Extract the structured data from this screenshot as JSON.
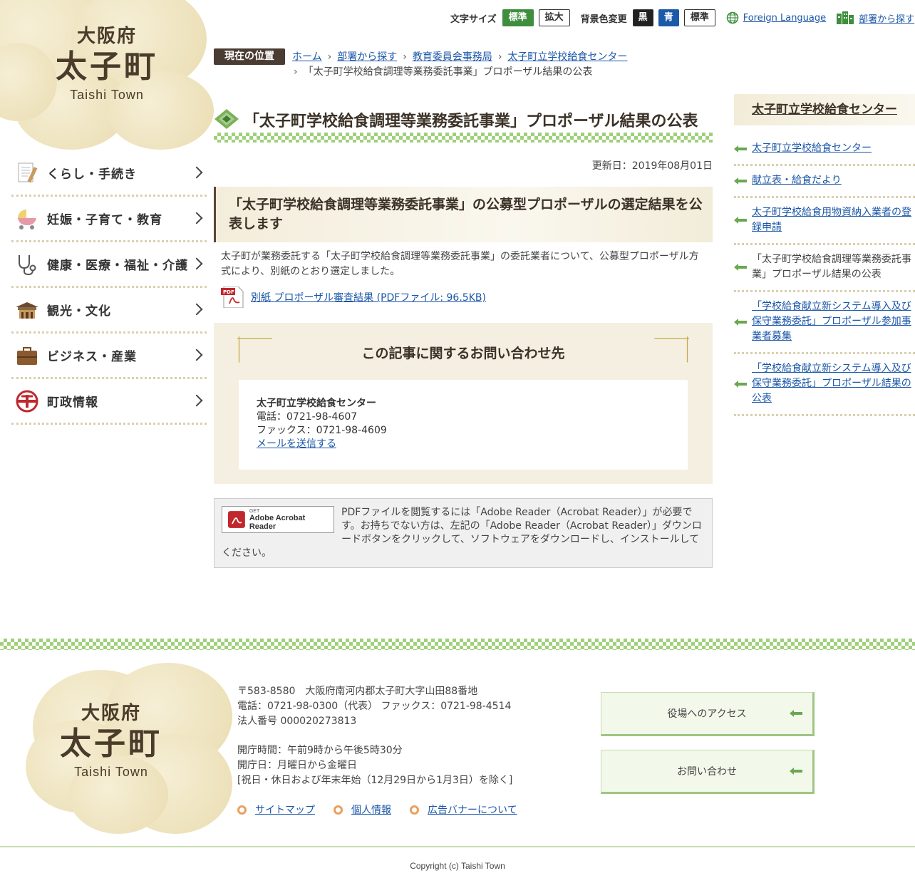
{
  "logo": {
    "pref": "大阪府",
    "town": "太子町",
    "en": "Taishi Town"
  },
  "topbar": {
    "font_size_label": "文字サイズ",
    "font_standard": "標準",
    "font_large": "拡大",
    "bg_label": "背景色変更",
    "bg_black": "黒",
    "bg_blue": "青",
    "bg_standard": "標準",
    "foreign": "Foreign Language",
    "dept": "部署から探す"
  },
  "breadcrumb": {
    "label": "現在の位置",
    "items": [
      "ホーム",
      "部署から探す",
      "教育委員会事務局",
      "太子町立学校給食センター"
    ],
    "current": "「太子町学校給食調理等業務委託事業」プロポーザル結果の公表"
  },
  "nav": {
    "items": [
      {
        "label": "くらし・手続き",
        "icon": "document-pen-icon"
      },
      {
        "label": "妊娠・子育て・教育",
        "icon": "baby-stroller-icon"
      },
      {
        "label": "健康・医療・福祉・介護",
        "icon": "stethoscope-icon"
      },
      {
        "label": "観光・文化",
        "icon": "temple-icon"
      },
      {
        "label": "ビジネス・産業",
        "icon": "briefcase-icon"
      },
      {
        "label": "町政情報",
        "icon": "town-emblem-icon"
      }
    ]
  },
  "main": {
    "title": "「太子町学校給食調理等業務委託事業」プロポーザル結果の公表",
    "updated": "更新日：2019年08月01日",
    "heading": "「太子町学校給食調理等業務委託事業」の公募型プロポーザルの選定結果を公表します",
    "body": "太子町が業務委託する「太子町学校給食調理等業務委託事業」の委託業者について、公募型プロポーザル方式により、別紙のとおり選定しました。",
    "pdf_link": "別紙 プロポーザル審査結果 (PDFファイル: 96.5KB)"
  },
  "contact": {
    "title": "この記事に関するお問い合わせ先",
    "name": "太子町立学校給食センター",
    "tel": "電話：0721-98-4607",
    "fax": "ファックス：0721-98-4609",
    "mail": "メールを送信する"
  },
  "acrobat": {
    "get": "GET",
    "product": "Adobe Acrobat Reader",
    "text": "PDFファイルを閲覧するには「Adobe Reader（Acrobat Reader）」が必要です。お持ちでない方は、左記の「Adobe Reader（Acrobat Reader）」ダウンロードボタンをクリックして、ソフトウェアをダウンロードし、インストールしてください。"
  },
  "sidebar": {
    "head": "太子町立学校給食センター",
    "items": [
      {
        "label": "太子町立学校給食センター",
        "link": true
      },
      {
        "label": "献立表・給食だより",
        "link": true
      },
      {
        "label": "太子町学校給食用物資納入業者の登録申請",
        "link": true
      },
      {
        "label": "「太子町学校給食調理等業務委託事業」プロポーザル結果の公表",
        "link": false
      },
      {
        "label": "「学校給食献立新システム導入及び保守業務委託」プロポーザル参加事業者募集",
        "link": true
      },
      {
        "label": "「学校給食献立新システム導入及び保守業務委託」プロポーザル結果の公表",
        "link": true
      }
    ]
  },
  "footer": {
    "address": "〒583-8580　大阪府南河内郡太子町大字山田88番地",
    "tel": "電話：0721-98-0300（代表） ファックス：0721-98-4514",
    "corp": "法人番号 000020273813",
    "hours": "開庁時間：午前9時から午後5時30分",
    "days": "開庁日：月曜日から金曜日",
    "holidays": "[祝日・休日および年末年始（12月29日から1月3日）を除く]",
    "links": [
      "サイトマップ",
      "個人情報",
      "広告バナーについて"
    ],
    "btn_access": "役場へのアクセス",
    "btn_contact": "お問い合わせ",
    "copyright": "Copyright (c) Taishi Town"
  },
  "colors": {
    "green": "#3e8e3e",
    "brown": "#4a3b33",
    "link": "#1a56a8",
    "check": "#9fd07a"
  }
}
